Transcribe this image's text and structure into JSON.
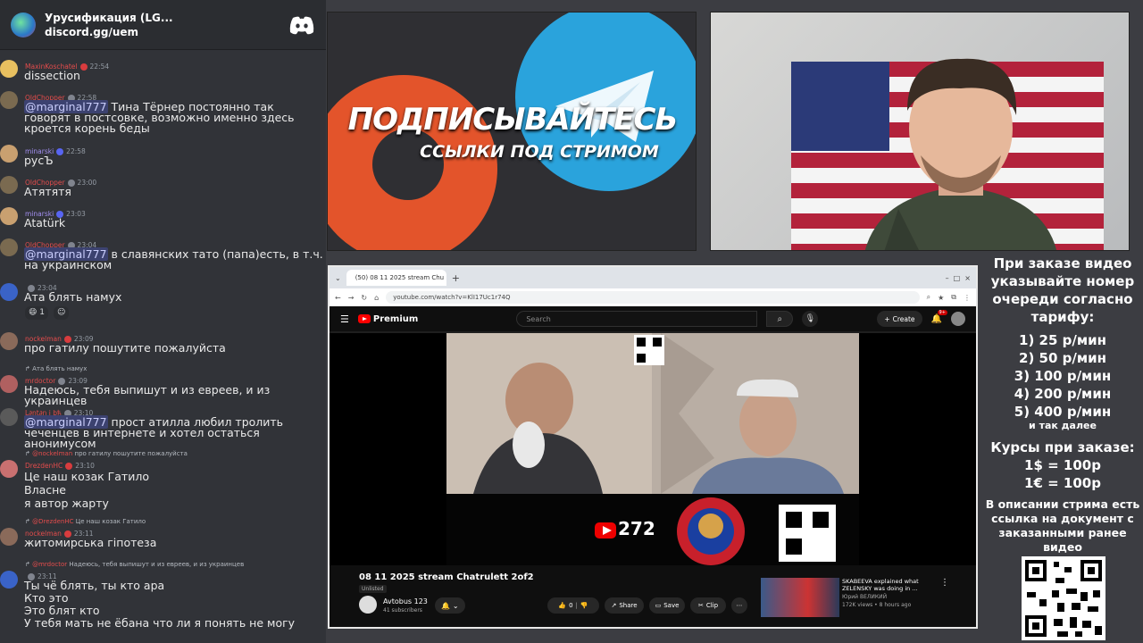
{
  "discord": {
    "server_name": "Урусификация (LG...",
    "invite": "discord.gg/uem"
  },
  "messages": [
    {
      "user": "MaxinKoschatel",
      "time": "22:54",
      "text": "dissection"
    },
    {
      "user": "OldChopper",
      "time": "22:58",
      "mention": "@marginal777",
      "text": " Тина Тёрнер постоянно так говорят в постсовке, возможно именно здесь кроется корень беды"
    },
    {
      "user": "minarski",
      "time": "22:58",
      "text": "русЪ"
    },
    {
      "user": "OldChopper",
      "time": "23:00",
      "text": "Атятятя"
    },
    {
      "user": "minarski",
      "time": "23:03",
      "text": "Atatürk"
    },
    {
      "user": "OldChopper",
      "time": "23:04",
      "mention": "@marginal777",
      "text": " в славянских тато (папа)есть, в т.ч. на украинском"
    },
    {
      "user": "",
      "time": "23:04",
      "text": "Ата блять намух",
      "reactions": [
        "😄 1",
        "☺"
      ]
    },
    {
      "user": "nockelman",
      "time": "23:09",
      "text": "про гатилу пошутите пожалуйста"
    },
    {
      "reply_user": "",
      "reply_text": "Ата блять намух",
      "user": "mrdoctor",
      "time": "23:09",
      "text": "Надеюсь, тебя выпишут и из евреев, и из украинцев"
    },
    {
      "user": "L∂nt∂n i bђ",
      "time": "23:10",
      "mention": "@marginal777",
      "text": " прост атилла любил тролить чеченцев в интернете и хотел остаться анонимусом"
    },
    {
      "reply_user": "@nockelman",
      "reply_text": "про гатилу пошутите пожалуйста",
      "user": "DrezdenHC",
      "time": "23:10",
      "lines": [
        "Це наш козак Гатило",
        "Власне",
        "я автор жарту"
      ]
    },
    {
      "reply_user": "@DrezdenHC",
      "reply_text": "Це наш козак Гатило",
      "user": "nockelman",
      "time": "23:11",
      "text": "житомирська гіпотеза"
    },
    {
      "reply_user": "@mrdoctor",
      "reply_text": "Надеюсь, тебя выпишут и из евреев, и из украинцев",
      "user": "",
      "time": "23:11",
      "lines": [
        "Ты чё блять, ты кто ара",
        "Кто это",
        "Это блят кто",
        "У тебя мать не ёбана что ли я понять не могу"
      ]
    }
  ],
  "promo": {
    "title": "ПОДПИСЫВАЙТЕСЬ",
    "subtitle": "ССЫЛКИ ПОД СТРИМОМ"
  },
  "browser": {
    "tab_title": "(50) 08 11 2025 stream Chu",
    "url": "youtube.com/watch?v=KlI17Uc1r74Q",
    "yt_brand": "Premium",
    "search_placeholder": "Search",
    "create_label": "Create",
    "notif_count": "9+",
    "video_overlay_count": "272",
    "video_title": "08 11 2025 stream Chatrulett 2of2",
    "visibility": "Unlisted",
    "channel_name": "Avtobus 123",
    "channel_subs": "41 subscribers",
    "likes": "0",
    "share_label": "Share",
    "save_label": "Save",
    "clip_label": "Clip",
    "rec_title": "SKABEEVA explained what ZELENSKY was doing in ...",
    "rec_channel": "Юрий ВЕЛИКИЙ",
    "rec_views": "172K views • 8 hours ago"
  },
  "info": {
    "order": "При заказе видео указывайте номер очереди согласно тарифу:",
    "prices": [
      "1) 25 р/мин",
      "2) 50 р/мин",
      "3) 100 р/мин",
      "4) 200 р/мин",
      "5) 400 р/мин"
    ],
    "more": "и так далее",
    "courses_title": "Курсы при заказе:",
    "usd": "1$ = 100р",
    "eur": "1€ = 100р",
    "desc": "В описании стрима есть ссылка на документ с заказанными ранее видео"
  }
}
